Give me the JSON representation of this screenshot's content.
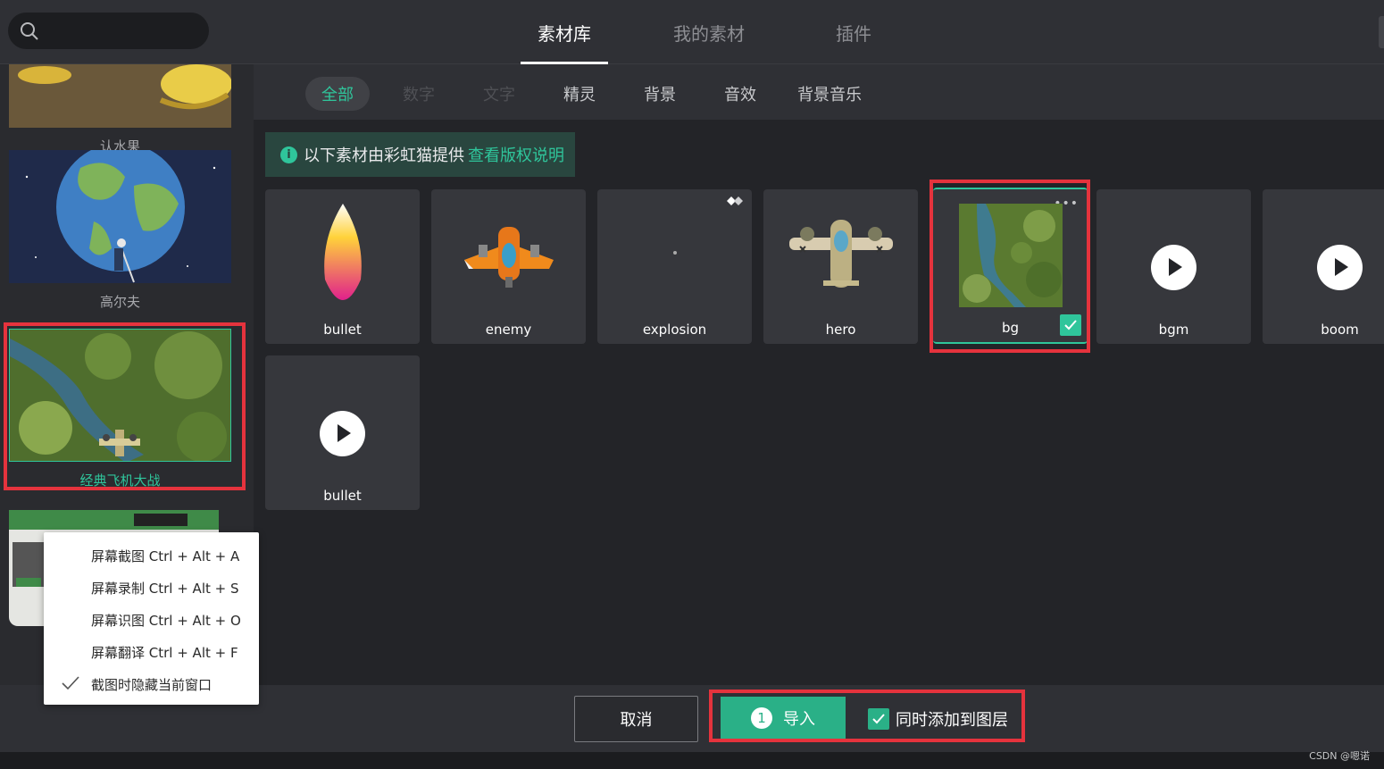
{
  "top_tabs": [
    {
      "label": "素材库",
      "active": true
    },
    {
      "label": "我的素材",
      "active": false
    },
    {
      "label": "插件",
      "active": false
    }
  ],
  "sidebar": {
    "projects": [
      {
        "label": "认水果"
      },
      {
        "label": "高尔夫"
      },
      {
        "label": "经典飞机大战",
        "selected": true
      }
    ]
  },
  "filters": [
    {
      "label": "全部",
      "state": "active"
    },
    {
      "label": "数字",
      "state": "disabled"
    },
    {
      "label": "文字",
      "state": "disabled"
    },
    {
      "label": "精灵",
      "state": "normal"
    },
    {
      "label": "背景",
      "state": "normal"
    },
    {
      "label": "音效",
      "state": "normal"
    },
    {
      "label": "背景音乐",
      "state": "normal"
    }
  ],
  "notice": {
    "text": "以下素材由彩虹猫提供",
    "link": "查看版权说明"
  },
  "assets": [
    {
      "name": "bullet"
    },
    {
      "name": "enemy"
    },
    {
      "name": "explosion"
    },
    {
      "name": "hero"
    },
    {
      "name": "bg",
      "selected": true
    },
    {
      "name": "bgm"
    },
    {
      "name": "boom"
    },
    {
      "name": "bullet"
    }
  ],
  "bottom": {
    "cancel": "取消",
    "import": "导入",
    "import_count": "1",
    "also_add": "同时添加到图层"
  },
  "context_menu": [
    "屏幕截图 Ctrl + Alt + A",
    "屏幕录制 Ctrl + Alt + S",
    "屏幕识图 Ctrl + Alt + O",
    "屏幕翻译 Ctrl + Alt + F",
    "截图时隐藏当前窗口"
  ],
  "watermark": "CSDN @嗯诺",
  "colors": {
    "accent": "#2fc59b",
    "highlight": "#e5333d",
    "background": "#232428"
  }
}
